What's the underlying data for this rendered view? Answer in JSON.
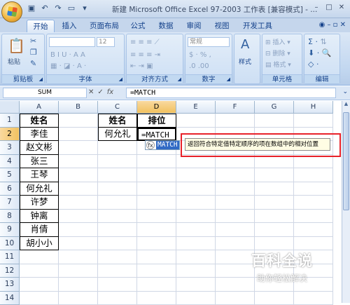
{
  "window": {
    "title": "新建 Microsoft Office Excel 97-2003 工作表 [兼容模式] - ...",
    "controls": [
      "–",
      "□",
      "✕"
    ]
  },
  "quick_access": [
    "save-icon",
    "undo-icon",
    "redo-icon",
    "print-preview-icon",
    "dropdown-icon"
  ],
  "ribbon_tabs": [
    "开始",
    "插入",
    "页面布局",
    "公式",
    "数据",
    "审阅",
    "视图",
    "开发工具"
  ],
  "ribbon": {
    "clipboard": {
      "paste_label": "粘贴",
      "group_label": "剪贴板"
    },
    "font": {
      "font_name": "",
      "font_size": "12",
      "group_label": "字体"
    },
    "alignment": {
      "group_label": "对齐方式"
    },
    "number": {
      "format": "常规",
      "group_label": "数字"
    },
    "styles": {
      "label": "样式"
    },
    "cells": {
      "insert": "插入",
      "delete": "删除",
      "format": "格式",
      "group_label": "单元格"
    },
    "editing": {
      "group_label": "编辑"
    }
  },
  "formula_bar": {
    "name_box": "SUM",
    "formula": "=MATCH"
  },
  "grid": {
    "columns": [
      "A",
      "B",
      "C",
      "D",
      "E",
      "F",
      "G",
      "H"
    ],
    "rows": [
      "1",
      "2",
      "3",
      "4",
      "5",
      "6",
      "7",
      "8",
      "9",
      "10",
      "11",
      "12",
      "13",
      "14"
    ],
    "cells": {
      "A1": "姓名",
      "A2": "李佳",
      "A3": "赵文彬",
      "A4": "张三",
      "A5": "王琴",
      "A6": "何允礼",
      "A7": "许梦",
      "A8": "钟离",
      "A9": "肖倩",
      "A10": "胡小小",
      "C1": "姓名",
      "C2": "何允礼",
      "D1": "排位",
      "D2": "=MATCH"
    }
  },
  "autocomplete": {
    "icon": "function-icon",
    "function_name": "MATCH",
    "tooltip": "返回符合特定值特定顺序的项在数组中的相对位置"
  },
  "watermark": {
    "title": "百科全说",
    "subtitle": "助你轻松解决"
  }
}
